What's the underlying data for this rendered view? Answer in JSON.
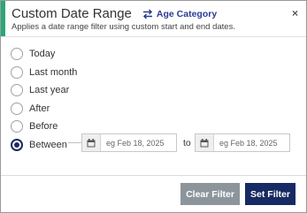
{
  "header": {
    "title": "Custom Date Range",
    "category_label": "Age Category",
    "subtitle": "Applies a date range filter using custom start and end dates.",
    "close_glyph": "×"
  },
  "options": [
    {
      "label": "Today",
      "checked": false
    },
    {
      "label": "Last month",
      "checked": false
    },
    {
      "label": "Last year",
      "checked": false
    },
    {
      "label": "After",
      "checked": false
    },
    {
      "label": "Before",
      "checked": false
    },
    {
      "label": "Between",
      "checked": true
    }
  ],
  "range": {
    "start_placeholder": "eg Feb 18, 2025",
    "end_placeholder": "eg Feb 18, 2025",
    "to_label": "to"
  },
  "footer": {
    "clear_label": "Clear Filter",
    "set_label": "Set Filter"
  },
  "colors": {
    "accent": "#2aa876",
    "primary": "#182a63",
    "secondary_button": "#8c959b"
  },
  "icons": {
    "category": "swap-arrows-icon",
    "close": "close-icon",
    "date": "calendar-icon"
  }
}
